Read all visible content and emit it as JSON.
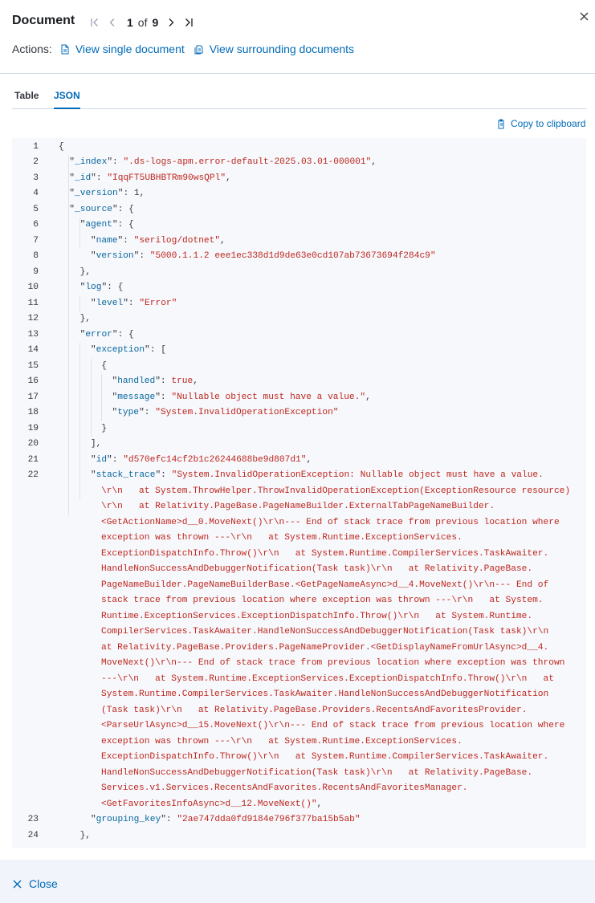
{
  "header": {
    "title": "Document",
    "pagination": {
      "current": "1",
      "of": "of",
      "total": "9"
    }
  },
  "actions": {
    "label": "Actions:",
    "view_single": "View single document",
    "view_surrounding": "View surrounding documents"
  },
  "tabs": [
    {
      "label": "Table"
    },
    {
      "label": "JSON"
    }
  ],
  "copy_label": "Copy to clipboard",
  "json_lines": [
    {
      "n": "1",
      "i": 0,
      "t": "{"
    },
    {
      "n": "2",
      "i": 1,
      "k": "_index",
      "v": "\".ds-logs-apm.error-default-2025.03.01-000001\"",
      "vt": "s",
      "e": ","
    },
    {
      "n": "3",
      "i": 1,
      "k": "_id",
      "v": "\"IqqFT5UBHBTRm90wsQPl\"",
      "vt": "s",
      "e": ","
    },
    {
      "n": "4",
      "i": 1,
      "k": "_version",
      "v": "1",
      "vt": "n",
      "e": ","
    },
    {
      "n": "5",
      "i": 1,
      "k": "_source",
      "t2": "{"
    },
    {
      "n": "6",
      "i": 2,
      "k": "agent",
      "t2": "{"
    },
    {
      "n": "7",
      "i": 3,
      "k": "name",
      "v": "\"serilog/dotnet\"",
      "vt": "s",
      "e": ","
    },
    {
      "n": "8",
      "i": 3,
      "k": "version",
      "v": "\"5000.1.1.2 eee1ec338d1d9de63e0cd107ab73673694f284c9\"",
      "vt": "s"
    },
    {
      "n": "9",
      "i": 2,
      "t": "},"
    },
    {
      "n": "10",
      "i": 2,
      "k": "log",
      "t2": "{"
    },
    {
      "n": "11",
      "i": 3,
      "k": "level",
      "v": "\"Error\"",
      "vt": "s"
    },
    {
      "n": "12",
      "i": 2,
      "t": "},"
    },
    {
      "n": "13",
      "i": 2,
      "k": "error",
      "t2": "{"
    },
    {
      "n": "14",
      "i": 3,
      "k": "exception",
      "t2": "["
    },
    {
      "n": "15",
      "i": 4,
      "t": "{"
    },
    {
      "n": "16",
      "i": 5,
      "k": "handled",
      "v": "true",
      "vt": "b",
      "e": ","
    },
    {
      "n": "17",
      "i": 5,
      "k": "message",
      "v": "\"Nullable object must have a value.\"",
      "vt": "s",
      "e": ","
    },
    {
      "n": "18",
      "i": 5,
      "k": "type",
      "v": "\"System.InvalidOperationException\"",
      "vt": "s"
    },
    {
      "n": "19",
      "i": 4,
      "t": "}"
    },
    {
      "n": "20",
      "i": 3,
      "t": "],"
    },
    {
      "n": "21",
      "i": 3,
      "k": "id",
      "v": "\"d570efc14cf2b1c26244688be9d807d1\"",
      "vt": "s",
      "e": ","
    },
    {
      "n": "22",
      "i": 3,
      "k": "stack_trace",
      "v": "\"System.InvalidOperationException: Nullable object must have a value.",
      "vt": "s"
    },
    {
      "n": "",
      "w": 1,
      "v": "\\r\\n   at System.ThrowHelper.ThrowInvalidOperationException(ExceptionResource resource)"
    },
    {
      "n": "",
      "w": 1,
      "v": "\\r\\n   at Relativity.PageBase.PageNameBuilder.ExternalTabPageNameBuilder."
    },
    {
      "n": "",
      "w": 1,
      "v": "<GetActionName>d__0.MoveNext()\\r\\n--- End of stack trace from previous location where"
    },
    {
      "n": "",
      "w": 1,
      "v": "exception was thrown ---\\r\\n   at System.Runtime.ExceptionServices."
    },
    {
      "n": "",
      "w": 1,
      "v": "ExceptionDispatchInfo.Throw()\\r\\n   at System.Runtime.CompilerServices.TaskAwaiter."
    },
    {
      "n": "",
      "w": 1,
      "v": "HandleNonSuccessAndDebuggerNotification(Task task)\\r\\n   at Relativity.PageBase."
    },
    {
      "n": "",
      "w": 1,
      "v": "PageNameBuilder.PageNameBuilderBase.<GetPageNameAsync>d__4.MoveNext()\\r\\n--- End of"
    },
    {
      "n": "",
      "w": 1,
      "v": "stack trace from previous location where exception was thrown ---\\r\\n   at System."
    },
    {
      "n": "",
      "w": 1,
      "v": "Runtime.ExceptionServices.ExceptionDispatchInfo.Throw()\\r\\n   at System.Runtime."
    },
    {
      "n": "",
      "w": 1,
      "v": "CompilerServices.TaskAwaiter.HandleNonSuccessAndDebuggerNotification(Task task)\\r\\n"
    },
    {
      "n": "",
      "w": 1,
      "v": "at Relativity.PageBase.Providers.PageNameProvider.<GetDisplayNameFromUrlAsync>d__4."
    },
    {
      "n": "",
      "w": 1,
      "v": "MoveNext()\\r\\n--- End of stack trace from previous location where exception was thrown"
    },
    {
      "n": "",
      "w": 1,
      "v": "---\\r\\n   at System.Runtime.ExceptionServices.ExceptionDispatchInfo.Throw()\\r\\n   at"
    },
    {
      "n": "",
      "w": 1,
      "v": "System.Runtime.CompilerServices.TaskAwaiter.HandleNonSuccessAndDebuggerNotification"
    },
    {
      "n": "",
      "w": 1,
      "v": "(Task task)\\r\\n   at Relativity.PageBase.Providers.RecentsAndFavoritesProvider."
    },
    {
      "n": "",
      "w": 1,
      "v": "<ParseUrlAsync>d__15.MoveNext()\\r\\n--- End of stack trace from previous location where"
    },
    {
      "n": "",
      "w": 1,
      "v": "exception was thrown ---\\r\\n   at System.Runtime.ExceptionServices."
    },
    {
      "n": "",
      "w": 1,
      "v": "ExceptionDispatchInfo.Throw()\\r\\n   at System.Runtime.CompilerServices.TaskAwaiter."
    },
    {
      "n": "",
      "w": 1,
      "v": "HandleNonSuccessAndDebuggerNotification(Task task)\\r\\n   at Relativity.PageBase."
    },
    {
      "n": "",
      "w": 1,
      "v": "Services.v1.Services.RecentsAndFavorites.RecentsAndFavoritesManager."
    },
    {
      "n": "",
      "w": 1,
      "v": "<GetFavoritesInfoAsync>d__12.MoveNext()\"",
      "e": ","
    },
    {
      "n": "23",
      "i": 3,
      "k": "grouping_key",
      "v": "\"2ae747dda0fd9184e796f377ba15b5ab\"",
      "vt": "s"
    },
    {
      "n": "24",
      "i": 2,
      "t": "},"
    }
  ],
  "footer": {
    "close_label": "Close"
  },
  "colors": {
    "accent": "#006bb8",
    "string": "#bd271e",
    "key": "#07669c",
    "code_bg": "#f7f8fc"
  }
}
